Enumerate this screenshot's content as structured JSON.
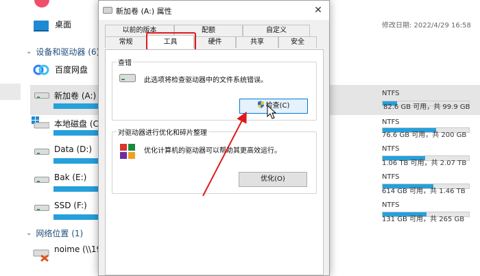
{
  "explorer": {
    "top_item": {
      "name": "桌面",
      "modified_label": "修改日期: 2022/4/29 16:58"
    },
    "section_devices": "设备和驱动器 (6)",
    "section_network": "网络位置 (1)",
    "baidu": "百度网盘",
    "drives": [
      {
        "name": "新加卷 (A:)",
        "fs": "NTFS",
        "capacity": "82.6 GB 可用，共 99.9 GB",
        "used_fraction": 0.17
      },
      {
        "name": "本地磁盘 (C:",
        "fs": "NTFS",
        "capacity": "76.6 GB 可用，共 200 GB",
        "used_fraction": 0.62
      },
      {
        "name": "Data (D:)",
        "fs": "NTFS",
        "capacity": "1.06 TB 可用，共 2.07 TB",
        "used_fraction": 0.49
      },
      {
        "name": "Bak (E:)",
        "fs": "NTFS",
        "capacity": "614 GB 可用，共 1.46 TB",
        "used_fraction": 0.59
      },
      {
        "name": "SSD (F:)",
        "fs": "NTFS",
        "capacity": "131 GB 可用，共 265 GB",
        "used_fraction": 0.51
      }
    ],
    "network_item": "noime (\\\\19"
  },
  "dialog": {
    "title": "新加卷 (A:) 属性",
    "close_glyph": "✕",
    "tabs_back": [
      "以前的版本",
      "配额",
      "自定义"
    ],
    "tabs_front": [
      "常规",
      "工具",
      "硬件",
      "共享",
      "安全"
    ],
    "active_tab": "工具",
    "check_group": {
      "title": "查错",
      "description": "此选项将检查驱动器中的文件系统错误。",
      "button": "检查(C)"
    },
    "optimize_group": {
      "title": "对驱动器进行优化和碎片整理",
      "description": "优化计算机的驱动器可以帮助其更高效运行。",
      "button": "优化(O)"
    }
  },
  "colors": {
    "accent": "#26a0da",
    "highlight": "#e0191d",
    "focus": "#0078d7"
  }
}
